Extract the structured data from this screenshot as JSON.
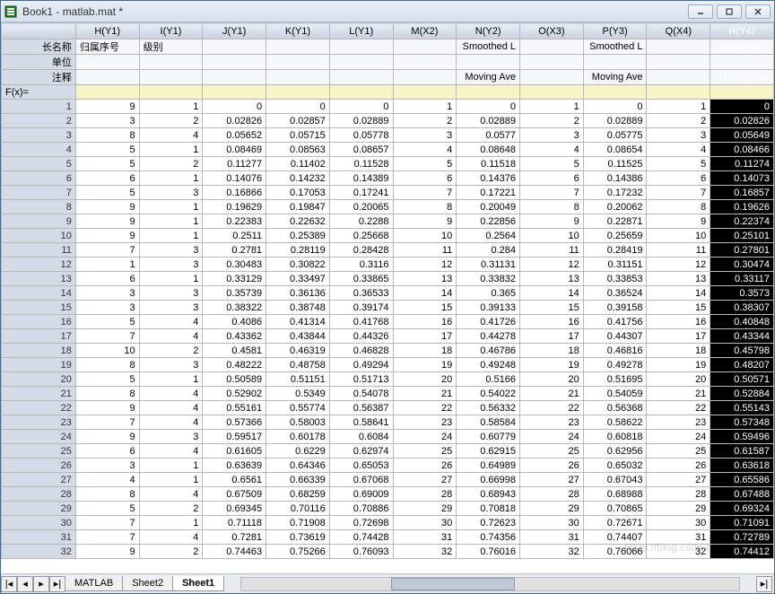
{
  "window": {
    "title": "Book1 - matlab.mat *"
  },
  "columns": [
    "H(Y1)",
    "I(Y1)",
    "J(Y1)",
    "K(Y1)",
    "L(Y1)",
    "M(X2)",
    "N(Y2)",
    "O(X3)",
    "P(Y3)",
    "Q(X4)",
    "R(Y4)"
  ],
  "labelRows": {
    "longname": {
      "hdr": "长名称",
      "vals": [
        "归属序号",
        "级别",
        "",
        "",
        "",
        "",
        "Smoothed L",
        "",
        "Smoothed L",
        "",
        "Smoothed L"
      ]
    },
    "unit": {
      "hdr": "单位",
      "vals": [
        "",
        "",
        "",
        "",
        "",
        "",
        "",
        "",
        "",
        "",
        ""
      ]
    },
    "comment": {
      "hdr": "注释",
      "vals": [
        "",
        "",
        "",
        "",
        "",
        "",
        "Moving Ave",
        "",
        "Moving Ave",
        "",
        "Moving Ave"
      ]
    },
    "fx": {
      "hdr": "F(x)=",
      "vals": [
        "",
        "",
        "",
        "",
        "",
        "",
        "",
        "",
        "",
        "",
        ""
      ]
    }
  },
  "rows": [
    {
      "n": 1,
      "c": [
        "9",
        "1",
        "0",
        "0",
        "0",
        "1",
        "0",
        "1",
        "0",
        "1",
        "0"
      ]
    },
    {
      "n": 2,
      "c": [
        "3",
        "2",
        "0.02826",
        "0.02857",
        "0.02889",
        "2",
        "0.02889",
        "2",
        "0.02889",
        "2",
        "0.02826"
      ]
    },
    {
      "n": 3,
      "c": [
        "8",
        "4",
        "0.05652",
        "0.05715",
        "0.05778",
        "3",
        "0.0577",
        "3",
        "0.05775",
        "3",
        "0.05649"
      ]
    },
    {
      "n": 4,
      "c": [
        "5",
        "1",
        "0.08469",
        "0.08563",
        "0.08657",
        "4",
        "0.08648",
        "4",
        "0.08654",
        "4",
        "0.08466"
      ]
    },
    {
      "n": 5,
      "c": [
        "5",
        "2",
        "0.11277",
        "0.11402",
        "0.11528",
        "5",
        "0.11518",
        "5",
        "0.11525",
        "5",
        "0.11274"
      ]
    },
    {
      "n": 6,
      "c": [
        "6",
        "1",
        "0.14076",
        "0.14232",
        "0.14389",
        "6",
        "0.14376",
        "6",
        "0.14386",
        "6",
        "0.14073"
      ]
    },
    {
      "n": 7,
      "c": [
        "5",
        "3",
        "0.16866",
        "0.17053",
        "0.17241",
        "7",
        "0.17221",
        "7",
        "0.17232",
        "7",
        "0.16857"
      ]
    },
    {
      "n": 8,
      "c": [
        "9",
        "1",
        "0.19629",
        "0.19847",
        "0.20065",
        "8",
        "0.20049",
        "8",
        "0.20062",
        "8",
        "0.19626"
      ]
    },
    {
      "n": 9,
      "c": [
        "9",
        "1",
        "0.22383",
        "0.22632",
        "0.2288",
        "9",
        "0.22856",
        "9",
        "0.22871",
        "9",
        "0.22374"
      ]
    },
    {
      "n": 10,
      "c": [
        "9",
        "1",
        "0.2511",
        "0.25389",
        "0.25668",
        "10",
        "0.2564",
        "10",
        "0.25659",
        "10",
        "0.25101"
      ]
    },
    {
      "n": 11,
      "c": [
        "7",
        "3",
        "0.2781",
        "0.28119",
        "0.28428",
        "11",
        "0.284",
        "11",
        "0.28419",
        "11",
        "0.27801"
      ]
    },
    {
      "n": 12,
      "c": [
        "1",
        "3",
        "0.30483",
        "0.30822",
        "0.3116",
        "12",
        "0.31131",
        "12",
        "0.31151",
        "12",
        "0.30474"
      ]
    },
    {
      "n": 13,
      "c": [
        "6",
        "1",
        "0.33129",
        "0.33497",
        "0.33865",
        "13",
        "0.33832",
        "13",
        "0.33853",
        "13",
        "0.33117"
      ]
    },
    {
      "n": 14,
      "c": [
        "3",
        "3",
        "0.35739",
        "0.36136",
        "0.36533",
        "14",
        "0.365",
        "14",
        "0.36524",
        "14",
        "0.3573"
      ]
    },
    {
      "n": 15,
      "c": [
        "3",
        "3",
        "0.38322",
        "0.38748",
        "0.39174",
        "15",
        "0.39133",
        "15",
        "0.39158",
        "15",
        "0.38307"
      ]
    },
    {
      "n": 16,
      "c": [
        "5",
        "4",
        "0.4086",
        "0.41314",
        "0.41768",
        "16",
        "0.41726",
        "16",
        "0.41756",
        "16",
        "0.40848"
      ]
    },
    {
      "n": 17,
      "c": [
        "7",
        "4",
        "0.43362",
        "0.43844",
        "0.44326",
        "17",
        "0.44278",
        "17",
        "0.44307",
        "17",
        "0.43344"
      ]
    },
    {
      "n": 18,
      "c": [
        "10",
        "2",
        "0.4581",
        "0.46319",
        "0.46828",
        "18",
        "0.46786",
        "18",
        "0.46816",
        "18",
        "0.45798"
      ]
    },
    {
      "n": 19,
      "c": [
        "8",
        "3",
        "0.48222",
        "0.48758",
        "0.49294",
        "19",
        "0.49248",
        "19",
        "0.49278",
        "19",
        "0.48207"
      ]
    },
    {
      "n": 20,
      "c": [
        "5",
        "1",
        "0.50589",
        "0.51151",
        "0.51713",
        "20",
        "0.5166",
        "20",
        "0.51695",
        "20",
        "0.50571"
      ]
    },
    {
      "n": 21,
      "c": [
        "8",
        "4",
        "0.52902",
        "0.5349",
        "0.54078",
        "21",
        "0.54022",
        "21",
        "0.54059",
        "21",
        "0.52884"
      ]
    },
    {
      "n": 22,
      "c": [
        "9",
        "4",
        "0.55161",
        "0.55774",
        "0.56387",
        "22",
        "0.56332",
        "22",
        "0.56368",
        "22",
        "0.55143"
      ]
    },
    {
      "n": 23,
      "c": [
        "7",
        "4",
        "0.57366",
        "0.58003",
        "0.58641",
        "23",
        "0.58584",
        "23",
        "0.58622",
        "23",
        "0.57348"
      ]
    },
    {
      "n": 24,
      "c": [
        "9",
        "3",
        "0.59517",
        "0.60178",
        "0.6084",
        "24",
        "0.60779",
        "24",
        "0.60818",
        "24",
        "0.59496"
      ]
    },
    {
      "n": 25,
      "c": [
        "6",
        "4",
        "0.61605",
        "0.6229",
        "0.62974",
        "25",
        "0.62915",
        "25",
        "0.62956",
        "25",
        "0.61587"
      ]
    },
    {
      "n": 26,
      "c": [
        "3",
        "1",
        "0.63639",
        "0.64346",
        "0.65053",
        "26",
        "0.64989",
        "26",
        "0.65032",
        "26",
        "0.63618"
      ]
    },
    {
      "n": 27,
      "c": [
        "4",
        "1",
        "0.6561",
        "0.66339",
        "0.67068",
        "27",
        "0.66998",
        "27",
        "0.67043",
        "27",
        "0.65586"
      ]
    },
    {
      "n": 28,
      "c": [
        "8",
        "4",
        "0.67509",
        "0.68259",
        "0.69009",
        "28",
        "0.68943",
        "28",
        "0.68988",
        "28",
        "0.67488"
      ]
    },
    {
      "n": 29,
      "c": [
        "5",
        "2",
        "0.69345",
        "0.70116",
        "0.70886",
        "29",
        "0.70818",
        "29",
        "0.70865",
        "29",
        "0.69324"
      ]
    },
    {
      "n": 30,
      "c": [
        "7",
        "1",
        "0.71118",
        "0.71908",
        "0.72698",
        "30",
        "0.72623",
        "30",
        "0.72671",
        "30",
        "0.71091"
      ]
    },
    {
      "n": 31,
      "c": [
        "7",
        "4",
        "0.7281",
        "0.73619",
        "0.74428",
        "31",
        "0.74356",
        "31",
        "0.74407",
        "31",
        "0.72789"
      ]
    },
    {
      "n": 32,
      "c": [
        "9",
        "2",
        "0.74463",
        "0.75266",
        "0.76093",
        "32",
        "0.76016",
        "32",
        "0.76066",
        "32",
        "0.74412"
      ]
    }
  ],
  "tabs": {
    "t1": "MATLAB",
    "t2": "Sheet2",
    "t3": "Sheet1"
  },
  "watermark": "https://blog.csdn.net/Temmie"
}
